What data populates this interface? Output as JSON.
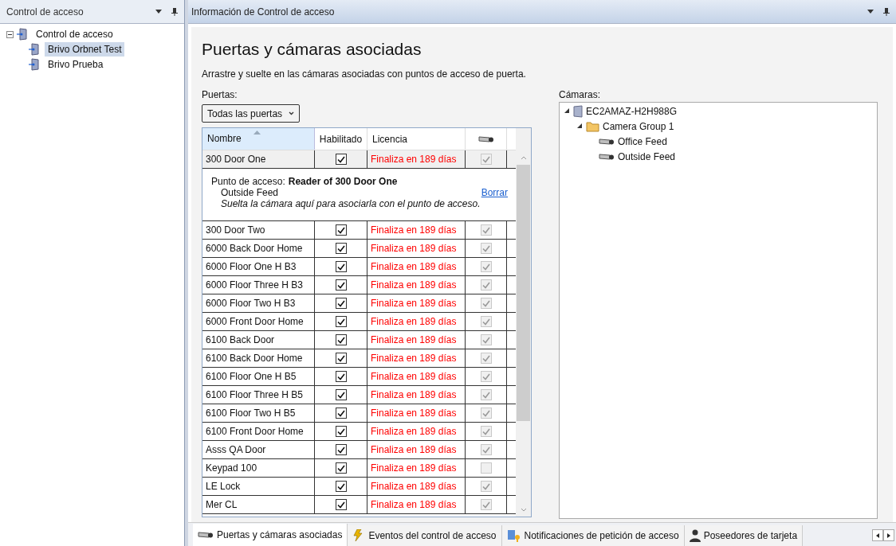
{
  "left_panel": {
    "title": "Control de acceso",
    "tree": [
      {
        "label": "Control de acceso",
        "expanded": true,
        "selected": false,
        "children": [
          {
            "label": "Brivo Orbnet Test",
            "selected": true
          },
          {
            "label": "Brivo Prueba",
            "selected": false
          }
        ]
      }
    ]
  },
  "main_panel": {
    "title": "Información de Control de acceso",
    "heading": "Puertas y cámaras asociadas",
    "description": "Arrastre y suelte en las cámaras asociadas con puntos de acceso de puerta.",
    "doors_label": "Puertas:",
    "filter": {
      "value": "Todas las puertas"
    },
    "table": {
      "columns": [
        "Nombre",
        "Habilitado",
        "Licencia"
      ],
      "rows": [
        {
          "name": "300 Door One",
          "selected": true,
          "enabled": true,
          "license": "Finaliza en 189 días",
          "camera": true,
          "access_point": {
            "label": "Punto de acceso:",
            "reader": "Reader of 300 Door One",
            "camera": "Outside Feed",
            "link": "Borrar",
            "hint": "Suelta la cámara aquí para asociarla con el punto de acceso."
          }
        },
        {
          "name": "300 Door Two",
          "selected": false,
          "enabled": true,
          "license": "Finaliza en 189 días",
          "camera": true
        },
        {
          "name": "6000 Back Door Home",
          "selected": false,
          "enabled": true,
          "license": "Finaliza en 189 días",
          "camera": true
        },
        {
          "name": "6000 Floor One H B3",
          "selected": false,
          "enabled": true,
          "license": "Finaliza en 189 días",
          "camera": true
        },
        {
          "name": "6000 Floor Three H B3",
          "selected": false,
          "enabled": true,
          "license": "Finaliza en 189 días",
          "camera": true
        },
        {
          "name": "6000 Floor Two H B3",
          "selected": false,
          "enabled": true,
          "license": "Finaliza en 189 días",
          "camera": true
        },
        {
          "name": "6000 Front Door Home",
          "selected": false,
          "enabled": true,
          "license": "Finaliza en 189 días",
          "camera": true
        },
        {
          "name": "6100 Back Door",
          "selected": false,
          "enabled": true,
          "license": "Finaliza en 189 días",
          "camera": true
        },
        {
          "name": "6100 Back Door Home",
          "selected": false,
          "enabled": true,
          "license": "Finaliza en 189 días",
          "camera": true
        },
        {
          "name": "6100 Floor One H B5",
          "selected": false,
          "enabled": true,
          "license": "Finaliza en 189 días",
          "camera": true
        },
        {
          "name": "6100 Floor Three H B5",
          "selected": false,
          "enabled": true,
          "license": "Finaliza en 189 días",
          "camera": true
        },
        {
          "name": "6100 Floor Two H B5",
          "selected": false,
          "enabled": true,
          "license": "Finaliza en 189 días",
          "camera": true
        },
        {
          "name": "6100 Front Door Home",
          "selected": false,
          "enabled": true,
          "license": "Finaliza en 189 días",
          "camera": true
        },
        {
          "name": "Asss QA Door",
          "selected": false,
          "enabled": true,
          "license": "Finaliza en 189 días",
          "camera": true
        },
        {
          "name": "Keypad 100",
          "selected": false,
          "enabled": true,
          "license": "Finaliza en 189 días",
          "camera": false
        },
        {
          "name": "LE Lock",
          "selected": false,
          "enabled": true,
          "license": "Finaliza en 189 días",
          "camera": true
        },
        {
          "name": "Mer CL",
          "selected": false,
          "enabled": true,
          "license": "Finaliza en 189 días",
          "camera": true
        }
      ]
    },
    "cameras_label": "Cámaras:",
    "cameras": [
      {
        "kind": "server",
        "label": "EC2AMAZ-H2H988G",
        "expanded": true,
        "children": [
          {
            "kind": "group",
            "label": "Camera Group 1",
            "expanded": true,
            "children": [
              {
                "kind": "camera",
                "label": "Office Feed"
              },
              {
                "kind": "camera",
                "label": "Outside Feed"
              }
            ]
          }
        ]
      }
    ]
  },
  "tabs": [
    {
      "label": "Puertas y cámaras asociadas",
      "kind": "cameras",
      "selected": true
    },
    {
      "label": "Eventos del control de acceso",
      "kind": "events",
      "selected": false
    },
    {
      "label": "Notificaciones de petición de acceso",
      "kind": "notifications",
      "selected": false
    },
    {
      "label": "Poseedores de tarjeta",
      "kind": "cardholders",
      "selected": false
    }
  ]
}
